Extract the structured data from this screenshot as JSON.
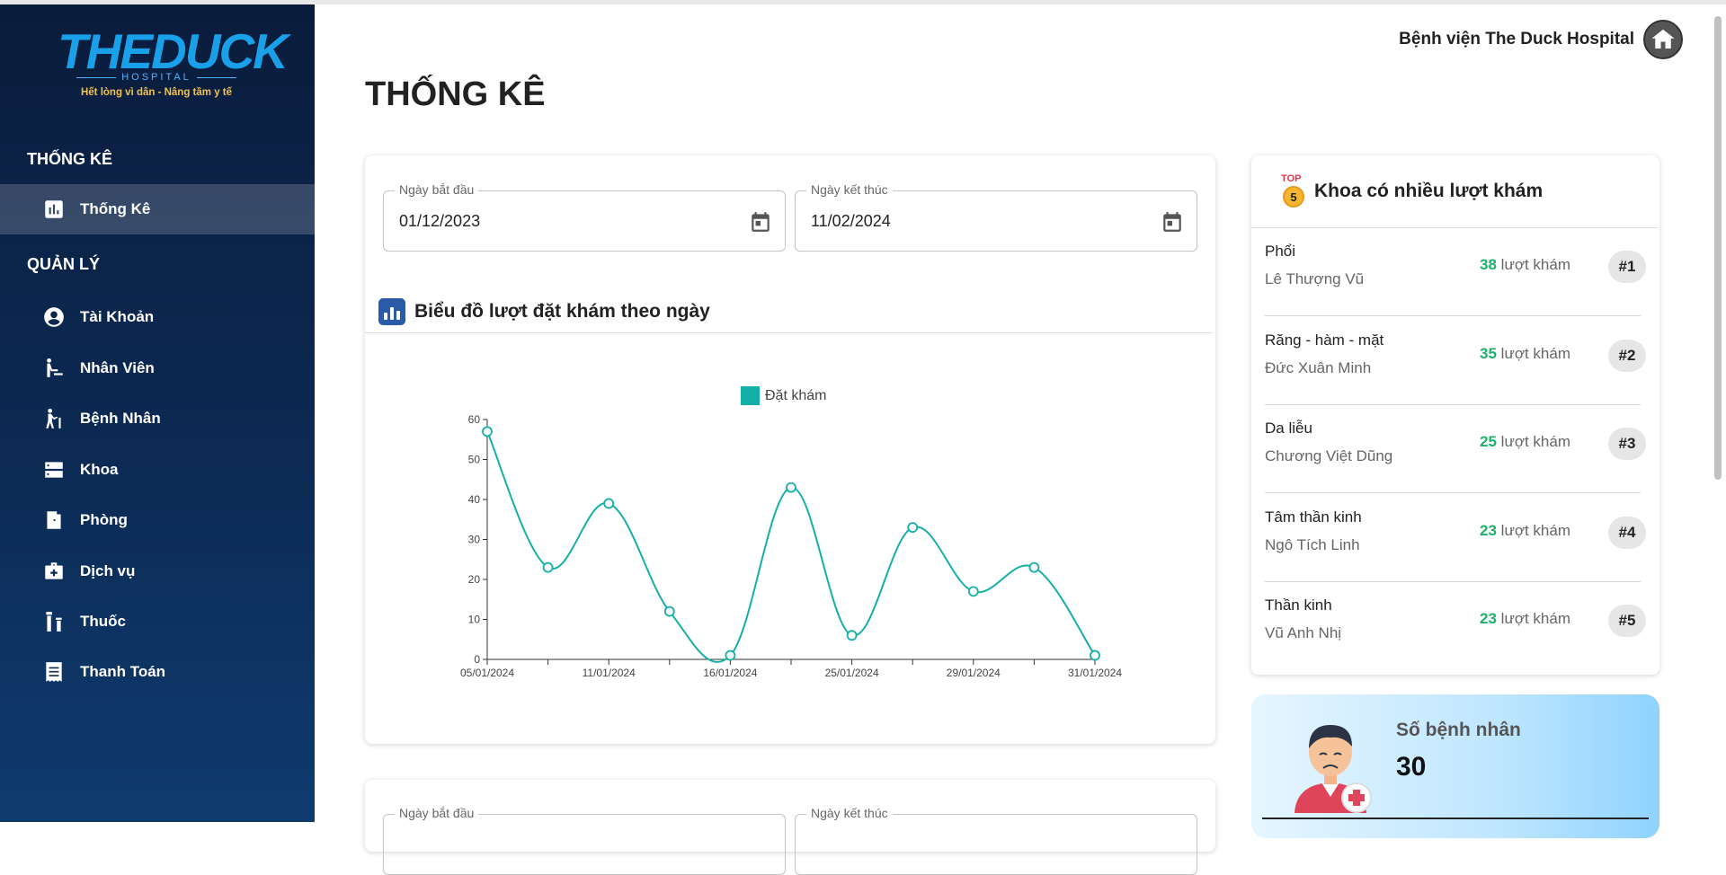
{
  "sidebar": {
    "logo": {
      "brand": "THEDUCK",
      "sub": "HOSPITAL",
      "slogan": "Hết lòng vì dân - Nâng tầm y tế"
    },
    "section_stats": "THỐNG KÊ",
    "section_manage": "QUẢN LÝ",
    "items": [
      {
        "label": "Thống Kê",
        "icon": "bar-chart-icon",
        "active": true
      },
      {
        "label": "Tài Khoản",
        "icon": "account-circle-icon"
      },
      {
        "label": "Nhân Viên",
        "icon": "staff-icon"
      },
      {
        "label": "Bệnh Nhân",
        "icon": "patient-icon"
      },
      {
        "label": "Khoa",
        "icon": "department-icon"
      },
      {
        "label": "Phòng",
        "icon": "room-door-icon"
      },
      {
        "label": "Dịch vụ",
        "icon": "medical-kit-icon"
      },
      {
        "label": "Thuốc",
        "icon": "medicine-icon"
      },
      {
        "label": "Thanh Toán",
        "icon": "receipt-icon"
      }
    ]
  },
  "header": {
    "hospital_name": "Bệnh viện The Duck Hospital",
    "home_icon": "home-icon"
  },
  "page_title": "THỐNG KÊ",
  "filters": {
    "start_label": "Ngày bắt đầu",
    "start_value": "01/12/2023",
    "end_label": "Ngày kết thúc",
    "end_value": "11/02/2024"
  },
  "filters2": {
    "start_label": "Ngày bắt đầu",
    "end_label": "Ngày kết thúc"
  },
  "chart_card": {
    "title": "Biểu đồ lượt đặt khám theo ngày"
  },
  "chart_data": {
    "type": "line",
    "title": "",
    "xlabel": "",
    "ylabel": "",
    "ylim": [
      0,
      60
    ],
    "yticks": [
      0,
      10,
      20,
      30,
      40,
      50,
      60
    ],
    "x": [
      "05/01/2024",
      "",
      "11/01/2024",
      "",
      "16/01/2024",
      "",
      "25/01/2024",
      "",
      "29/01/2024",
      "",
      "31/01/2024"
    ],
    "series": [
      {
        "name": "Đặt khám",
        "color": "#14b0a8",
        "values": [
          57,
          23,
          39,
          12,
          1,
          43,
          6,
          33,
          17,
          23,
          1
        ]
      }
    ],
    "legend": "top-center",
    "grid": false
  },
  "ranking": {
    "title": "Khoa có nhiều lượt khám",
    "top_badge": "TOP",
    "top_number": "5",
    "unit": "lượt khám",
    "rows": [
      {
        "department": "Phổi",
        "doctor": "Lê Thượng Vũ",
        "count": "38",
        "rank": "#1"
      },
      {
        "department": "Răng - hàm - mặt",
        "doctor": "Đức Xuân Minh",
        "count": "35",
        "rank": "#2"
      },
      {
        "department": "Da liễu",
        "doctor": "Chương Việt Dũng",
        "count": "25",
        "rank": "#3"
      },
      {
        "department": "Tâm thần kinh",
        "doctor": "Ngô Tích Linh",
        "count": "23",
        "rank": "#4"
      },
      {
        "department": "Thần kinh",
        "doctor": "Vũ Anh Nhị",
        "count": "23",
        "rank": "#5"
      }
    ]
  },
  "patient_stat": {
    "label": "Số bệnh nhân",
    "value": "30"
  }
}
